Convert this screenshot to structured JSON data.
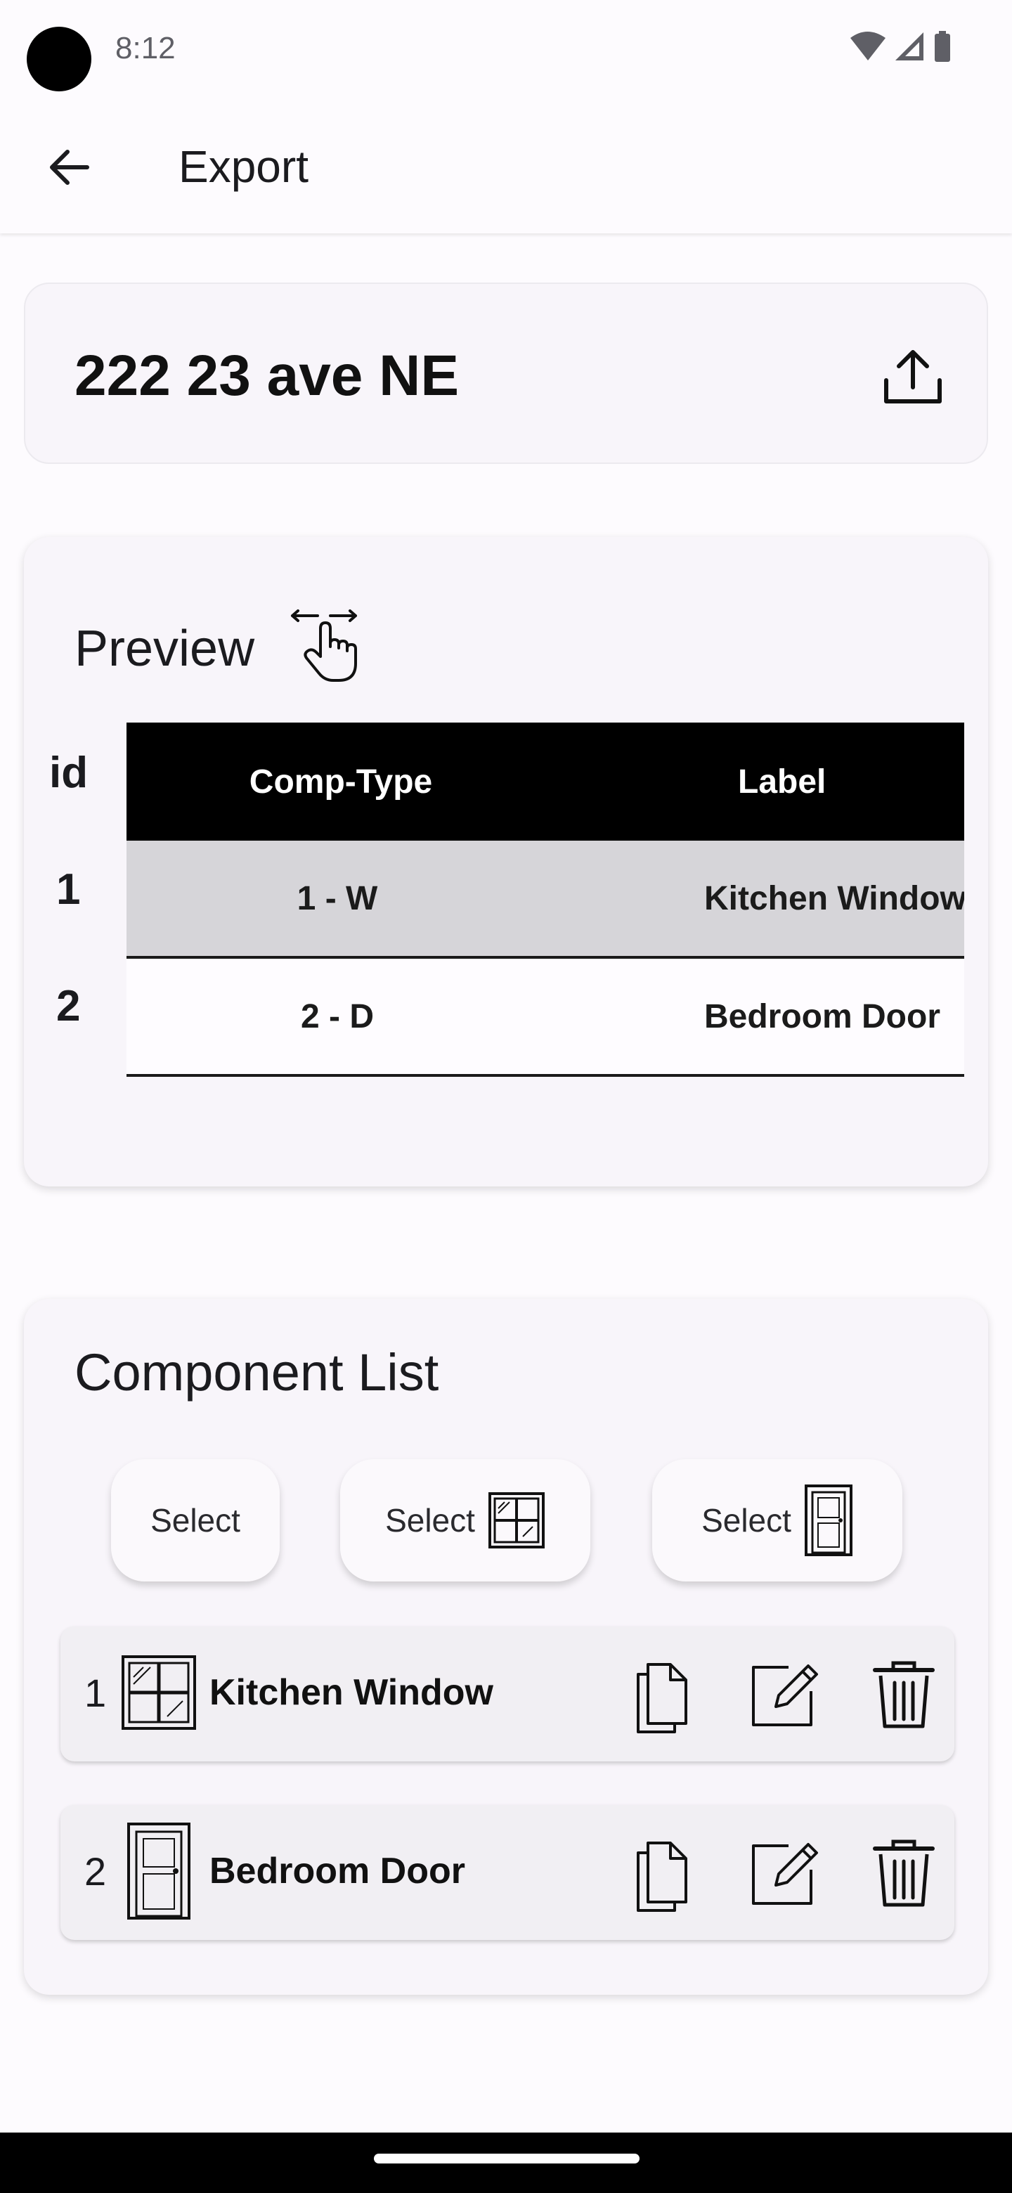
{
  "status_bar": {
    "time": "8:12",
    "icons": [
      "wifi-icon",
      "signal-icon",
      "battery-icon"
    ]
  },
  "app_bar": {
    "title": "Export",
    "back_icon": "arrow-left-icon"
  },
  "address_card": {
    "address": "222 23 ave NE",
    "share_icon": "share-upload-icon"
  },
  "preview": {
    "title": "Preview",
    "hint_icon": "swipe-horizontal-icon",
    "table": {
      "id_header": "id",
      "columns": [
        "Comp-Type",
        "Label"
      ],
      "rows": [
        {
          "id": "1",
          "comp_type": "1 - W",
          "label": "Kitchen Window"
        },
        {
          "id": "2",
          "comp_type": "2 - D",
          "label": "Bedroom Door"
        }
      ]
    }
  },
  "component_list": {
    "title": "Component List",
    "select_buttons": [
      {
        "label": "Select",
        "icon": ""
      },
      {
        "label": "Select",
        "icon": "window-icon"
      },
      {
        "label": "Select",
        "icon": "door-icon"
      }
    ],
    "items": [
      {
        "number": "1",
        "name": "Kitchen Window",
        "icon": "window-icon"
      },
      {
        "number": "2",
        "name": "Bedroom Door",
        "icon": "door-icon"
      }
    ],
    "actions": [
      "copy-icon",
      "edit-icon",
      "delete-icon"
    ]
  },
  "colors": {
    "background": "#fdfbfe",
    "card": "#f8f5fa",
    "table_header": "#000000",
    "table_row_alt": "#d6d5d9"
  }
}
